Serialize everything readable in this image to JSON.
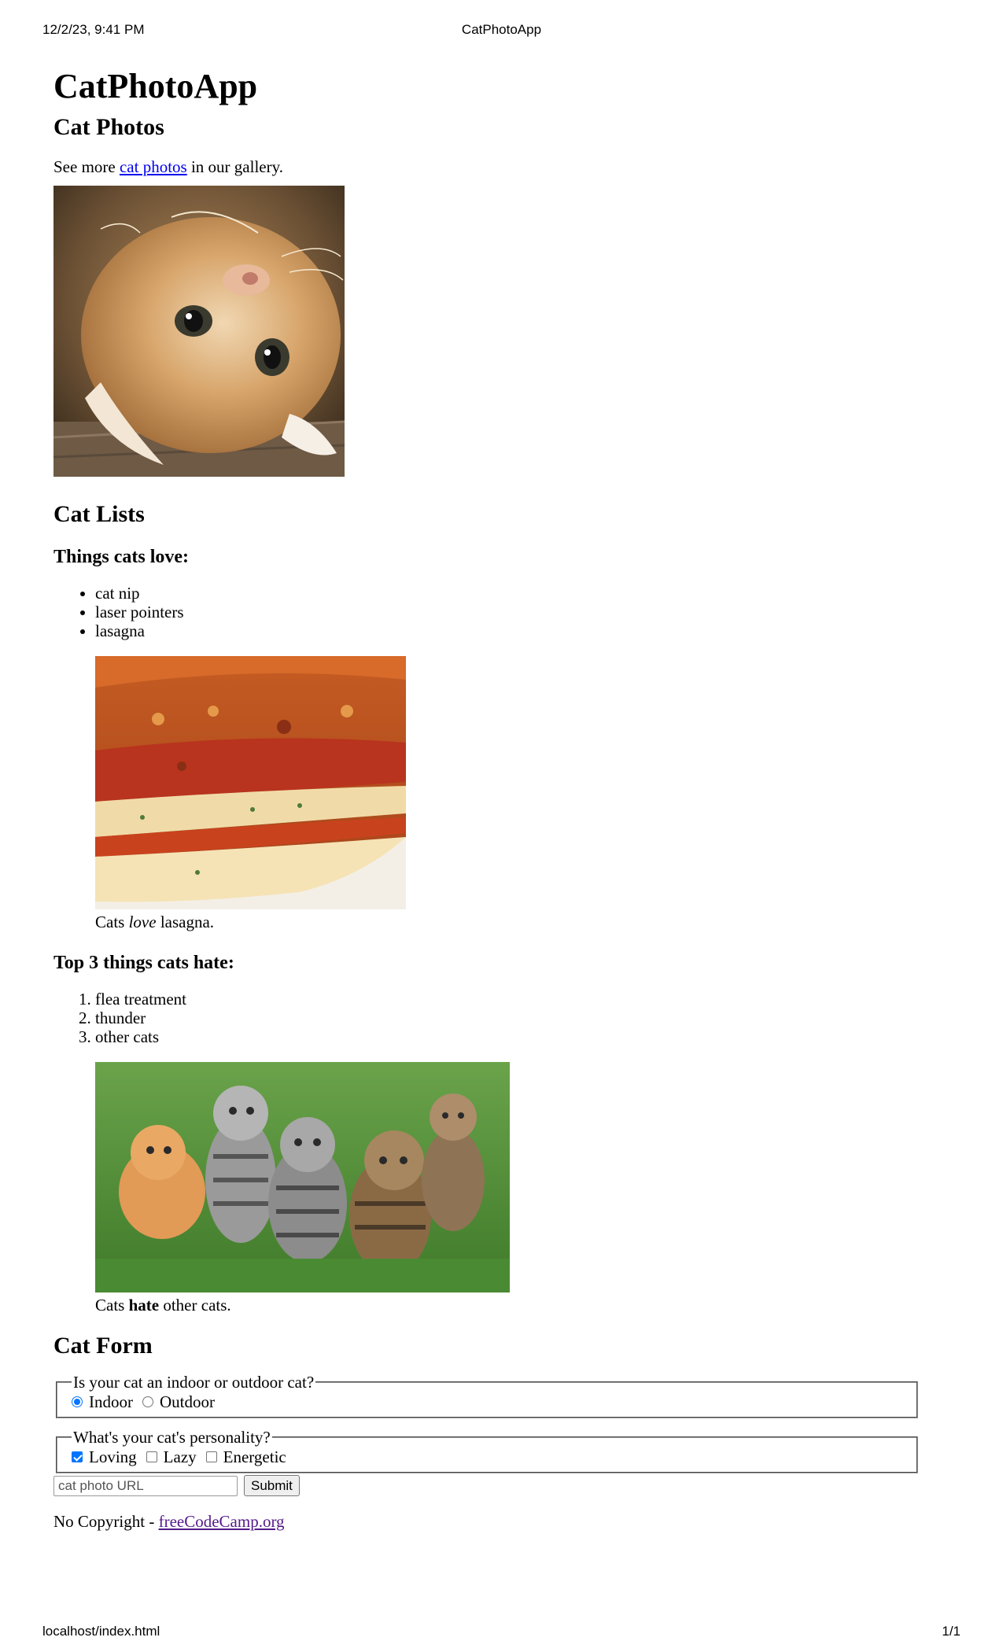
{
  "print": {
    "datetime": "12/2/23, 9:41 PM",
    "title": "CatPhotoApp",
    "url": "localhost/index.html",
    "page": "1/1"
  },
  "main": {
    "title": "CatPhotoApp",
    "photos_section": {
      "heading": "Cat Photos",
      "intro_before": "See more ",
      "intro_link": "cat photos",
      "intro_after": " in our gallery.",
      "image_desc": "cat photo"
    },
    "lists_section": {
      "heading": "Cat Lists",
      "love_heading": "Things cats love:",
      "love_items": [
        "cat nip",
        "laser pointers",
        "lasagna"
      ],
      "lasagna_caption_before": "Cats ",
      "lasagna_caption_emph": "love",
      "lasagna_caption_after": " lasagna.",
      "hate_heading": "Top 3 things cats hate:",
      "hate_items": [
        "flea treatment",
        "thunder",
        "other cats"
      ],
      "kittens_caption_before": "Cats ",
      "kittens_caption_strong": "hate",
      "kittens_caption_after": " other cats."
    },
    "form_section": {
      "heading": "Cat Form",
      "location_legend": "Is your cat an indoor or outdoor cat?",
      "location_options": [
        {
          "label": "Indoor",
          "checked": true
        },
        {
          "label": "Outdoor",
          "checked": false
        }
      ],
      "personality_legend": "What's your cat's personality?",
      "personality_options": [
        {
          "label": "Loving",
          "checked": true
        },
        {
          "label": "Lazy",
          "checked": false
        },
        {
          "label": "Energetic",
          "checked": false
        }
      ],
      "url_placeholder": "cat photo URL",
      "submit_label": "Submit"
    }
  },
  "footer": {
    "text_before": "No Copyright - ",
    "link_text": "freeCodeCamp.org"
  }
}
